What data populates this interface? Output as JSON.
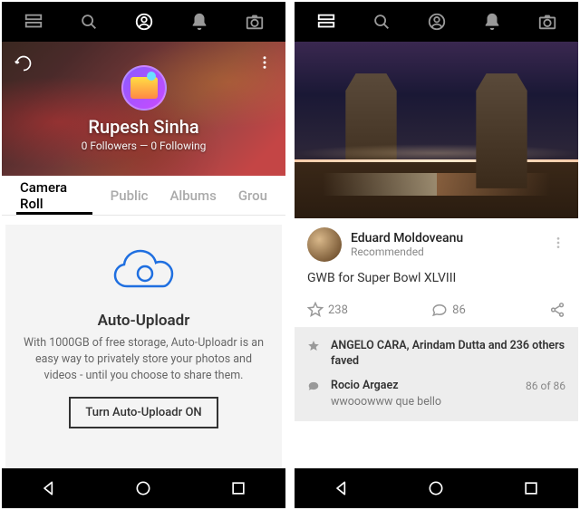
{
  "left": {
    "user": {
      "name": "Rupesh Sinha",
      "followers": 0,
      "following": 0,
      "stats_text": "0 Followers — 0 Following"
    },
    "tabs": [
      "Camera Roll",
      "Public",
      "Albums",
      "Grou"
    ],
    "promo": {
      "title": "Auto-Uploadr",
      "desc": "With 1000GB of free storage, Auto-Uploadr is an easy way to privately store your photos and videos - until you choose to share them.",
      "button": "Turn Auto-Uploadr ON"
    }
  },
  "right": {
    "post": {
      "author": "Eduard Moldoveanu",
      "rec": "Recommended",
      "title": "GWB for Super Bowl XLVIII",
      "faves": 238,
      "comments": 86
    },
    "activity": {
      "fave_text": "ANGELO CARA, Arindam Dutta and 236 others faved",
      "comment_author": "Rocio Argaez",
      "comment_text": "wwooowww que bello",
      "comment_count": "86 of 86"
    }
  }
}
